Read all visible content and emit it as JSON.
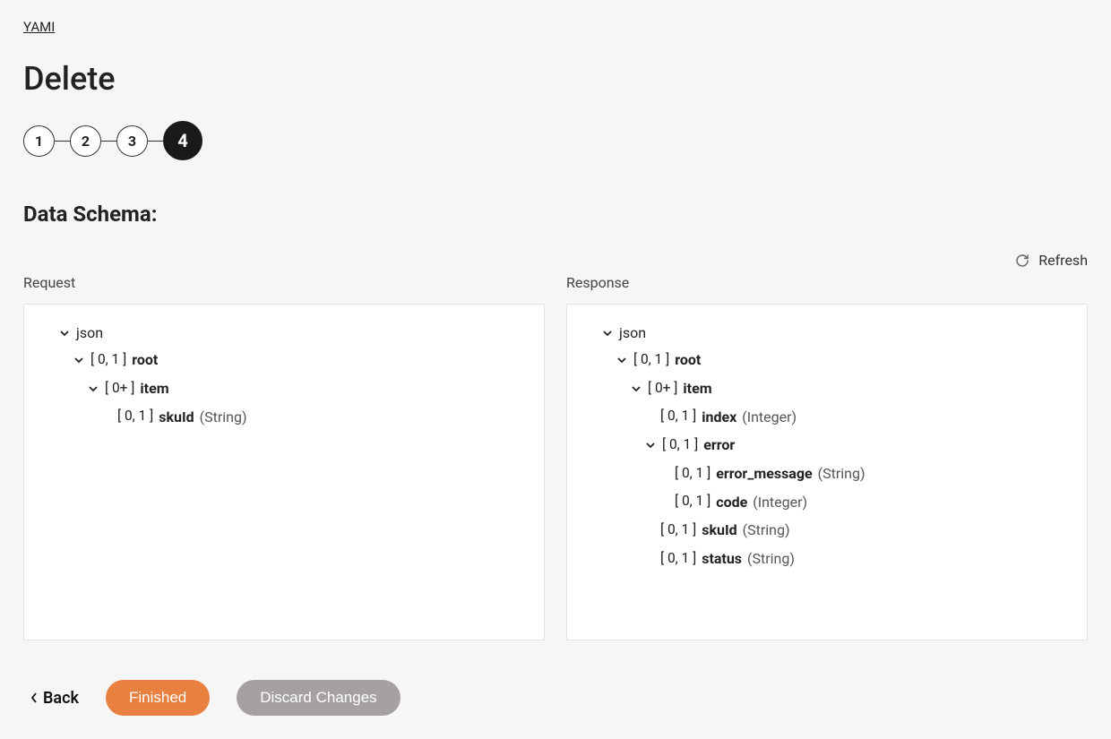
{
  "breadcrumb": "YAMI",
  "title": "Delete",
  "steps": {
    "s1": "1",
    "s2": "2",
    "s3": "3",
    "s4": "4"
  },
  "section_title": "Data Schema:",
  "refresh_label": "Refresh",
  "panels": {
    "request_label": "Request",
    "response_label": "Response"
  },
  "request_tree": {
    "json": "json",
    "root_card": "[ 0, 1 ]",
    "root_name": "root",
    "item_card": "[ 0+ ]",
    "item_name": "item",
    "skuid_card": "[ 0, 1 ]",
    "skuid_name": "skuId",
    "skuid_type": "(String)"
  },
  "response_tree": {
    "json": "json",
    "root_card": "[ 0, 1 ]",
    "root_name": "root",
    "item_card": "[ 0+ ]",
    "item_name": "item",
    "index_card": "[ 0, 1 ]",
    "index_name": "index",
    "index_type": "(Integer)",
    "error_card": "[ 0, 1 ]",
    "error_name": "error",
    "errmsg_card": "[ 0, 1 ]",
    "errmsg_name": "error_message",
    "errmsg_type": "(String)",
    "code_card": "[ 0, 1 ]",
    "code_name": "code",
    "code_type": "(Integer)",
    "skuid_card": "[ 0, 1 ]",
    "skuid_name": "skuId",
    "skuid_type": "(String)",
    "status_card": "[ 0, 1 ]",
    "status_name": "status",
    "status_type": "(String)"
  },
  "footer": {
    "back": "Back",
    "finished": "Finished",
    "discard": "Discard Changes"
  }
}
